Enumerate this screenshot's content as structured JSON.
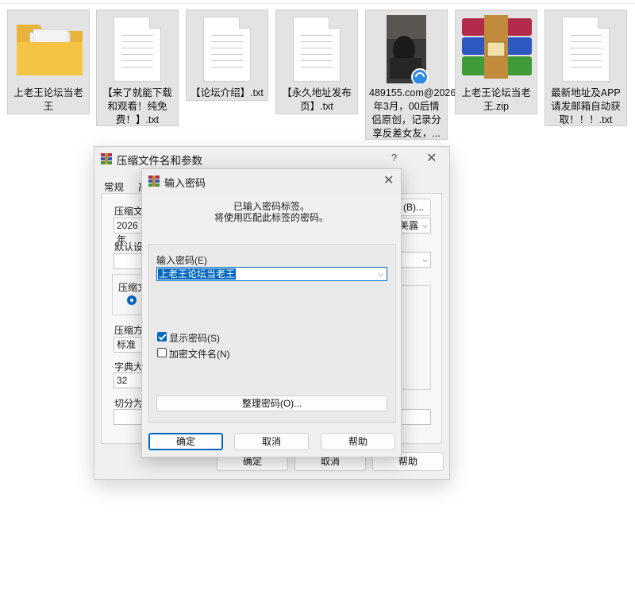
{
  "desktop": {
    "files": [
      {
        "name": "上老王论坛当老王",
        "type": "folder-icon"
      },
      {
        "name": "【来了就能下载和观看！纯免费！】.txt",
        "type": "text-file-icon"
      },
      {
        "name": "【论坛介绍】.txt",
        "type": "text-file-icon"
      },
      {
        "name": "【永久地址发布页】.txt",
        "type": "text-file-icon"
      },
      {
        "name": "489155.com@2026年3月，00后情侣原创，记录分享反差女友，...",
        "type": "video-file-icon"
      },
      {
        "name": "上老王论坛当老王.zip",
        "type": "winrar-archive-icon"
      },
      {
        "name": "最新地址及APP请发邮箱自动获取！！！.txt",
        "type": "text-file-icon"
      }
    ]
  },
  "archive_dialog": {
    "title": "压缩文件名和参数",
    "help": "?",
    "close": "✕",
    "tabs": [
      "常规",
      "高"
    ],
    "filename_label": "压缩文",
    "filename_value": "2026年",
    "browse_label": "(B)...",
    "profile_value": "美露",
    "default_label": "默认设置",
    "format_label": "压缩文",
    "method_label": "压缩方式",
    "method_value": "标准",
    "dict_label": "字典大小",
    "dict_value": "32",
    "split_label": "切分为分",
    "ok": "确定",
    "cancel": "取消",
    "help_button": "帮助"
  },
  "password_dialog": {
    "title": "输入密码",
    "close": "✕",
    "info_line1": "已输入密码标签。",
    "info_line2": "将使用匹配此标签的密码。",
    "password_label": "输入密码(E)",
    "password_value": "上老王论坛当老王",
    "show_password": "显示密码(S)",
    "show_password_checked": true,
    "encrypt_names": "加密文件名(N)",
    "encrypt_names_checked": false,
    "organize": "整理密码(O)...",
    "ok": "确定",
    "cancel": "取消",
    "help": "帮助"
  }
}
